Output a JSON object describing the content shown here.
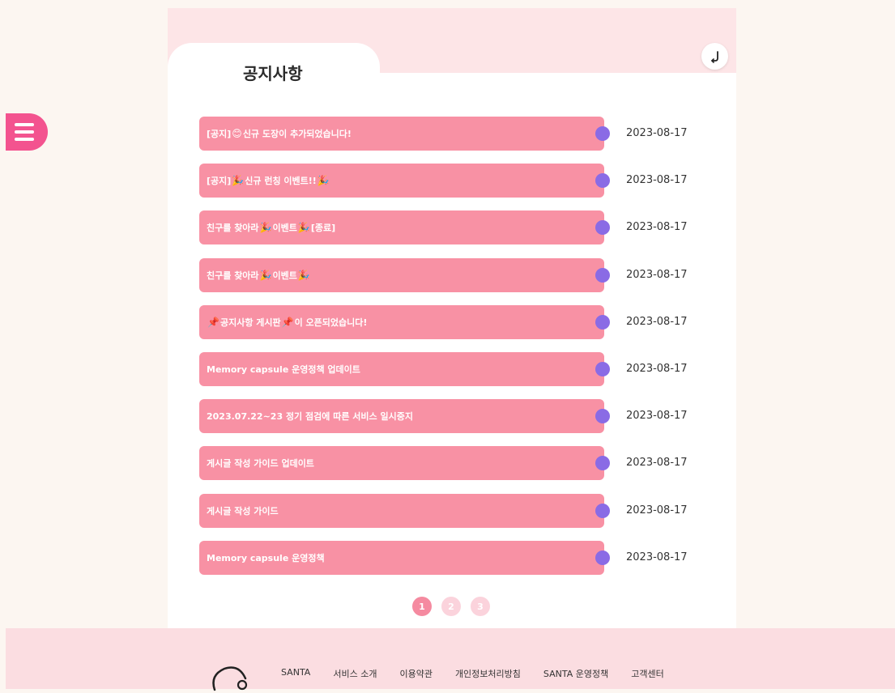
{
  "page": {
    "title": "공지사항"
  },
  "notices": [
    {
      "parts": [
        {
          "t": "[공지] "
        },
        {
          "emoji": "smile"
        },
        {
          "t": "신규 도장이 추가되었습니다!"
        }
      ],
      "date": "2023-08-17"
    },
    {
      "parts": [
        {
          "t": "[공지] "
        },
        {
          "emoji": "party"
        },
        {
          "t": "신규 런칭 이벤트!!"
        },
        {
          "emoji": "party"
        }
      ],
      "date": "2023-08-17"
    },
    {
      "parts": [
        {
          "t": "친구를 찾아라 "
        },
        {
          "emoji": "party"
        },
        {
          "t": "이벤트"
        },
        {
          "emoji": "party"
        },
        {
          "t": " [종료]"
        }
      ],
      "date": "2023-08-17"
    },
    {
      "parts": [
        {
          "t": "친구를 찾아라 "
        },
        {
          "emoji": "party"
        },
        {
          "t": "이벤트"
        },
        {
          "emoji": "party"
        }
      ],
      "date": "2023-08-17"
    },
    {
      "parts": [
        {
          "emoji": "pin"
        },
        {
          "t": "공지사항 게시판"
        },
        {
          "emoji": "pin"
        },
        {
          "t": "이 오픈되었습니다!"
        }
      ],
      "date": "2023-08-17"
    },
    {
      "parts": [
        {
          "t": "Memory capsule 운영정책 업데이트"
        }
      ],
      "date": "2023-08-17"
    },
    {
      "parts": [
        {
          "t": "2023.07.22~23 정기 점검에 따른 서비스 일시중지"
        }
      ],
      "date": "2023-08-17"
    },
    {
      "parts": [
        {
          "t": "게시글 작성 가이드 업데이트"
        }
      ],
      "date": "2023-08-17"
    },
    {
      "parts": [
        {
          "t": "게시글 작성 가이드"
        }
      ],
      "date": "2023-08-17"
    },
    {
      "parts": [
        {
          "t": "Memory capsule 운영정책"
        }
      ],
      "date": "2023-08-17"
    }
  ],
  "emoji_map": {
    "smile": "😊",
    "party": "🎉",
    "pin": "📌"
  },
  "pagination": {
    "pages": [
      "1",
      "2",
      "3"
    ],
    "current": "1"
  },
  "footer": {
    "links": [
      "SANTA",
      "서비스 소개",
      "이용약관",
      "개인정보처리방침",
      "SANTA 운영정책",
      "고객센터"
    ]
  },
  "icons": {
    "menu": "hamburger-icon",
    "back": "return-arrow-icon",
    "logo": "santa-logo-icon"
  },
  "colors": {
    "accent": "#f3538f",
    "notice_pill": "#f891a4",
    "notice_dot": "#8a6be5",
    "header_band": "#fde5e7",
    "footer_bg": "#fbdde1",
    "page_bg": "#fcf6f1"
  }
}
